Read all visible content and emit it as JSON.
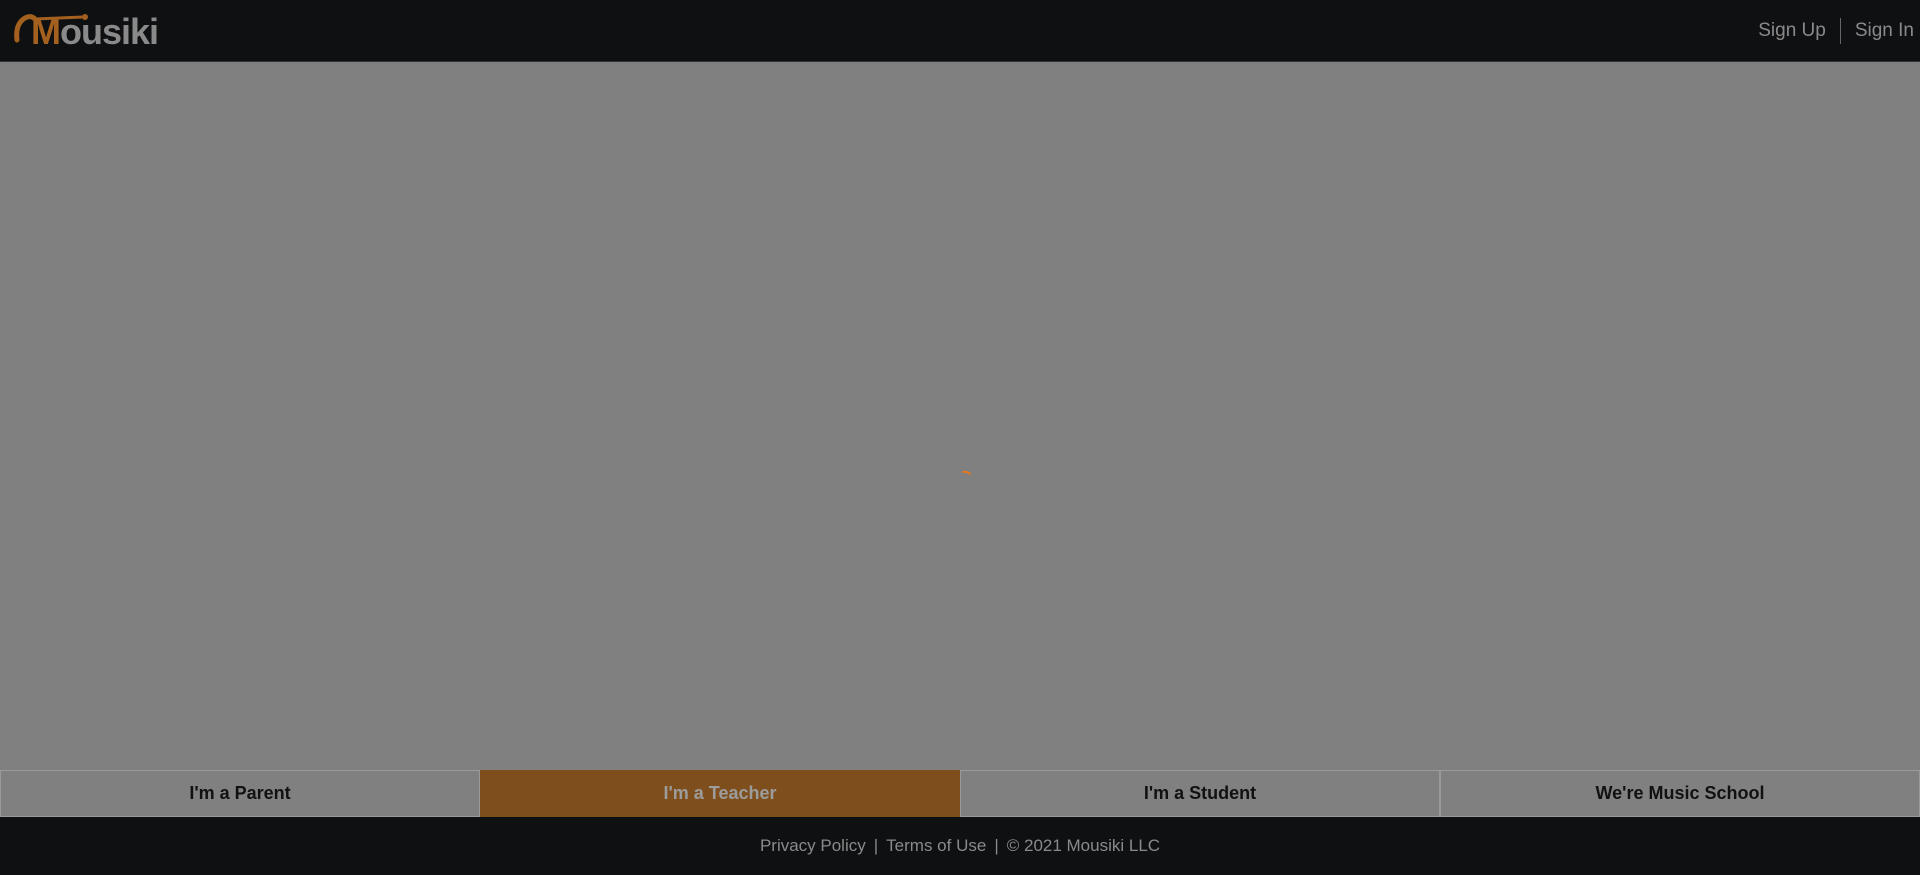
{
  "header": {
    "logo_text": "ousiki",
    "logo_initial": "M",
    "sign_up": "Sign Up",
    "sign_in": "Sign In"
  },
  "tabs": [
    {
      "label": "I'm a Parent",
      "active": false
    },
    {
      "label": "I'm a Teacher",
      "active": true
    },
    {
      "label": "I'm a Student",
      "active": false
    },
    {
      "label": "We're Music School",
      "active": false
    }
  ],
  "footer": {
    "privacy": "Privacy Policy",
    "terms": "Terms of Use",
    "copyright": "© 2021 Mousiki LLC",
    "separator": "|"
  },
  "colors": {
    "accent": "#a3601e",
    "active_tab": "#7e4f1d",
    "header_bg": "#0f1012",
    "overlay": "#808080"
  }
}
